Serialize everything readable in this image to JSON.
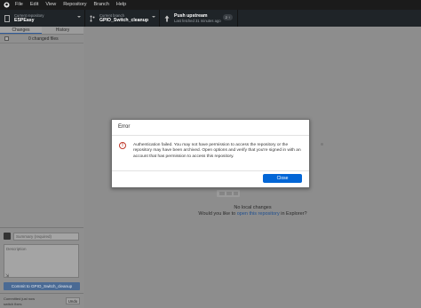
{
  "menubar": {
    "items": [
      "File",
      "Edit",
      "View",
      "Repository",
      "Branch",
      "Help"
    ]
  },
  "toolbar": {
    "repo_label": "Current repository",
    "repo_value": "ESPEasy",
    "branch_label": "Current branch",
    "branch_value": "GPIO_Switch_cleanup",
    "push_label": "Push upstream",
    "push_value": "Last fetched 31 minutes ago",
    "push_badge": "2 ↑"
  },
  "sidebar": {
    "tab_changes": "Changes",
    "tab_history": "History",
    "changed_files": "0 changed files",
    "summary_placeholder": "Summary (required)",
    "description_placeholder": "Description",
    "commit_button": "Commit to GPIO_Switch_cleanup",
    "last_commit_label": "Committed just now",
    "last_commit_title": "switch fixes",
    "undo_label": "Undo"
  },
  "main": {
    "no_changes": "No local changes",
    "prompt_pre": "Would you like to ",
    "prompt_link": "open this repository",
    "prompt_post": " in Explorer?"
  },
  "dialog": {
    "title": "Error",
    "message": "Authentication failed. You may not have permission to access the repository or the repository may have been archived. Open options and verify that you're signed in with an account that has permission to access this repository.",
    "close_label": "Close"
  },
  "colors": {
    "accent": "#0366d6",
    "error": "#c0392b",
    "toolbar_bg": "#1f2428"
  }
}
